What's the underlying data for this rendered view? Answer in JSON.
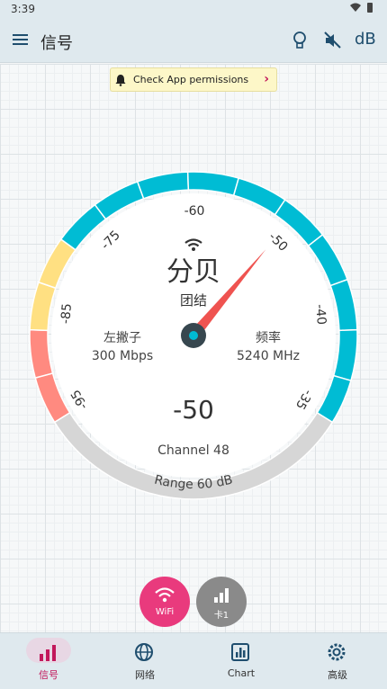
{
  "status_bar": {
    "time": "3:39"
  },
  "app_bar": {
    "title": "信号",
    "unit_label": "dB"
  },
  "permission_chip": {
    "label": "Check App permissions"
  },
  "gauge": {
    "ticks": [
      "-95",
      "-85",
      "-75",
      "-60",
      "-50",
      "-40",
      "-35"
    ],
    "value_label": "分贝",
    "ssid": "团结",
    "left_label": "左撇子",
    "left_value": "300 Mbps",
    "right_label": "频率",
    "right_value": "5240 MHz",
    "reading": "-50",
    "channel": "Channel 48",
    "range": "Range 60 dB",
    "needle_value_dbm": -50,
    "colors": {
      "excellent": "#00bcd4",
      "fair": "#ffe082",
      "poor": "#ff8a80",
      "empty": "#d6d6d6",
      "needle": "#ef5350",
      "hub": "#37474f",
      "hub_center": "#00bcd4"
    }
  },
  "fabs": [
    {
      "label": "WiFi",
      "icon": "wifi-icon",
      "color": "#e93a7d"
    },
    {
      "label": "卡1",
      "icon": "signal-bars-icon",
      "color": "#8a8a8a"
    }
  ],
  "nav": [
    {
      "label": "信号",
      "icon": "signal-bars-icon",
      "active": true
    },
    {
      "label": "网络",
      "icon": "globe-icon",
      "active": false
    },
    {
      "label": "Chart",
      "icon": "chart-icon",
      "active": false
    },
    {
      "label": "高级",
      "icon": "settings-icon",
      "active": false
    }
  ],
  "accent_color": "#c2185b"
}
